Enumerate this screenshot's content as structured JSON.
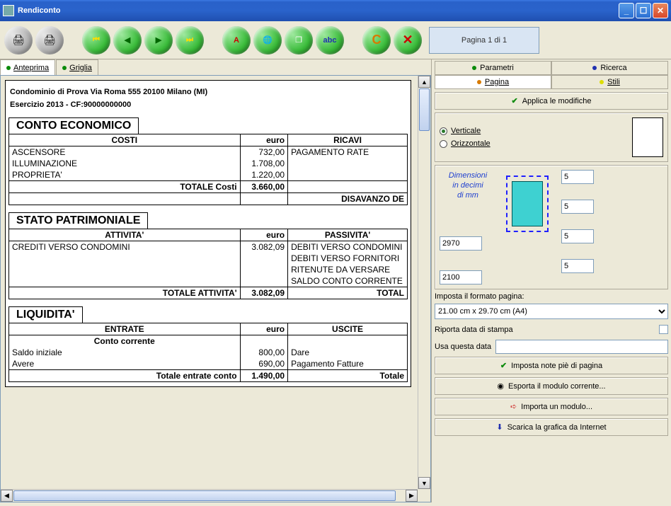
{
  "window": {
    "title": "Rendiconto"
  },
  "toolbar": {
    "page_indicator": "Pagina 1 di 1"
  },
  "left_tabs": {
    "anteprima": "Anteprima",
    "griglia": "Griglia"
  },
  "doc": {
    "header_line1": "Condominio di Prova Via Roma 555  20100 Milano (MI)",
    "header_line2": "Esercizio 2013 - CF:90000000000",
    "conto_economico": {
      "title": "CONTO ECONOMICO",
      "costi_hdr": "COSTI",
      "euro": "euro",
      "ricavi_hdr": "RICAVI",
      "rows": [
        {
          "c": "ASCENSORE",
          "v": "732,00",
          "r": "PAGAMENTO RATE"
        },
        {
          "c": "ILLUMINAZIONE",
          "v": "1.708,00",
          "r": ""
        },
        {
          "c": "PROPRIETA'",
          "v": "1.220,00",
          "r": ""
        }
      ],
      "tot_label": "TOTALE Costi",
      "tot_val": "3.660,00",
      "disavanzo": "DISAVANZO DE"
    },
    "stato_patrimoniale": {
      "title": "STATO PATRIMONIALE",
      "att_hdr": "ATTIVITA'",
      "euro": "euro",
      "pas_hdr": "PASSIVITA'",
      "rows": [
        {
          "a": "CREDITI VERSO CONDOMINI",
          "v": "3.082,09",
          "p": "DEBITI VERSO CONDOMINI"
        },
        {
          "a": "",
          "v": "",
          "p": "DEBITI VERSO FORNITORI"
        },
        {
          "a": "",
          "v": "",
          "p": "RITENUTE DA VERSARE"
        },
        {
          "a": "",
          "v": "",
          "p": "SALDO CONTO CORRENTE"
        }
      ],
      "tot_label": "TOTALE ATTIVITA'",
      "tot_val": "3.082,09",
      "tot_right": "TOTAL"
    },
    "liquidita": {
      "title": "LIQUIDITA'",
      "ent_hdr": "ENTRATE",
      "euro": "euro",
      "usc_hdr": "USCITE",
      "conto_corrente": "Conto corrente",
      "rows": [
        {
          "e": "Saldo iniziale",
          "v": "800,00",
          "u": "Dare"
        },
        {
          "e": "Avere",
          "v": "690,00",
          "u": "Pagamento Fatture"
        }
      ],
      "tot_label": "Totale entrate conto",
      "tot_val": "1.490,00",
      "tot_right": "Totale"
    }
  },
  "right": {
    "tabs": {
      "parametri": "Parametri",
      "ricerca": "Ricerca",
      "pagina": "Pagina",
      "stili": "Stili"
    },
    "applica": "Applica le modifiche",
    "orient": {
      "verticale": "Verticale",
      "orizzontale": "Orizzontale"
    },
    "dim": {
      "label_l1": "Dimensioni",
      "label_l2": "in decimi",
      "label_l3": "di mm",
      "height": "2970",
      "width": "2100",
      "m_top": "5",
      "m_right": "5",
      "m_bottom": "5",
      "m_left": "5"
    },
    "formato_label": "Imposta il formato pagina:",
    "formato_value": "21.00 cm x 29.70 cm (A4)",
    "riporta": "Riporta data di stampa",
    "usa_data": "Usa questa data",
    "note_pie": "Imposta note piè di pagina",
    "esporta": "Esporta il modulo corrente...",
    "importa": "Importa un modulo...",
    "scarica": "Scarica la grafica da Internet"
  }
}
